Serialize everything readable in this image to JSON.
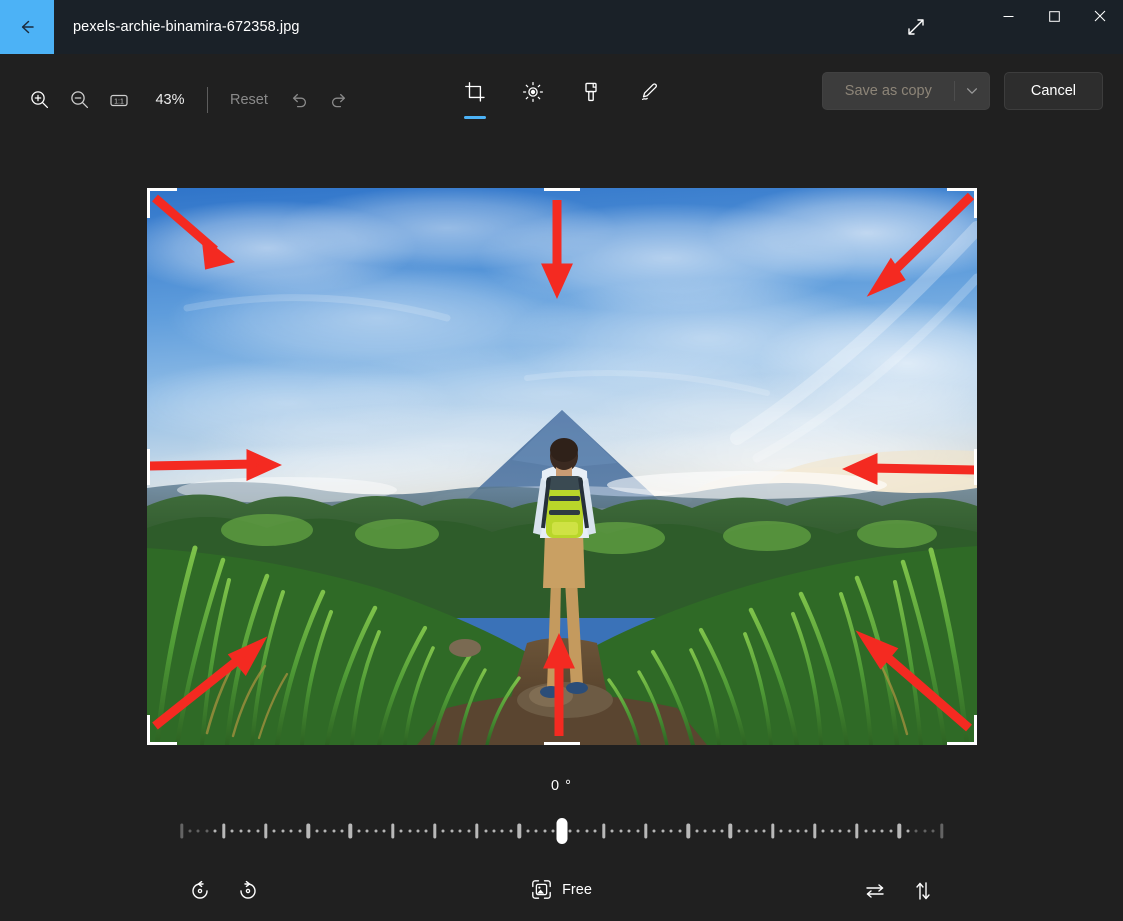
{
  "titlebar": {
    "back_label": "back-arrow",
    "filename": "pexels-archie-binamira-672358.jpg",
    "expand_label": "expand",
    "minimize_label": "–",
    "maximize_label": "□",
    "close_label": "✕"
  },
  "toolbar": {
    "zoom_in_label": "zoom-in",
    "zoom_out_label": "zoom-out",
    "actual_size_label": "1:1",
    "zoom_percent": "43%",
    "reset_label": "Reset",
    "undo_label": "undo",
    "redo_label": "redo",
    "tools": [
      {
        "name": "crop",
        "label": "Crop",
        "active": true
      },
      {
        "name": "adjustment",
        "label": "Adjustment",
        "active": false
      },
      {
        "name": "markup",
        "label": "Markup",
        "active": false
      },
      {
        "name": "retouch",
        "label": "Retouch",
        "active": false
      }
    ],
    "save_as_copy_label": "Save as copy",
    "save_disabled": true,
    "save_chevron_label": "chevron-down",
    "cancel_label": "Cancel"
  },
  "canvas": {
    "image_alt": "Hiker with yellow backpack standing on grassy hill overlooking Mayon volcano",
    "crop_active": true,
    "annotation_arrows": 8
  },
  "rotation": {
    "value": "0",
    "unit": "°",
    "display": "0 °",
    "min": -45,
    "max": 45,
    "tick_total": 91
  },
  "bottombar": {
    "rotate_left_label": "Rotate left",
    "rotate_right_label": "Rotate right",
    "aspect_ratio_label": "Free",
    "flip_horizontal_label": "Flip horizontal",
    "flip_vertical_label": "Flip vertical"
  },
  "colors": {
    "titlebar_bg": "#1a2128",
    "body_bg": "#202020",
    "accent": "#4cb2f6",
    "arrow_red": "#f42a21",
    "disabled_text": "#8a8a8a"
  }
}
